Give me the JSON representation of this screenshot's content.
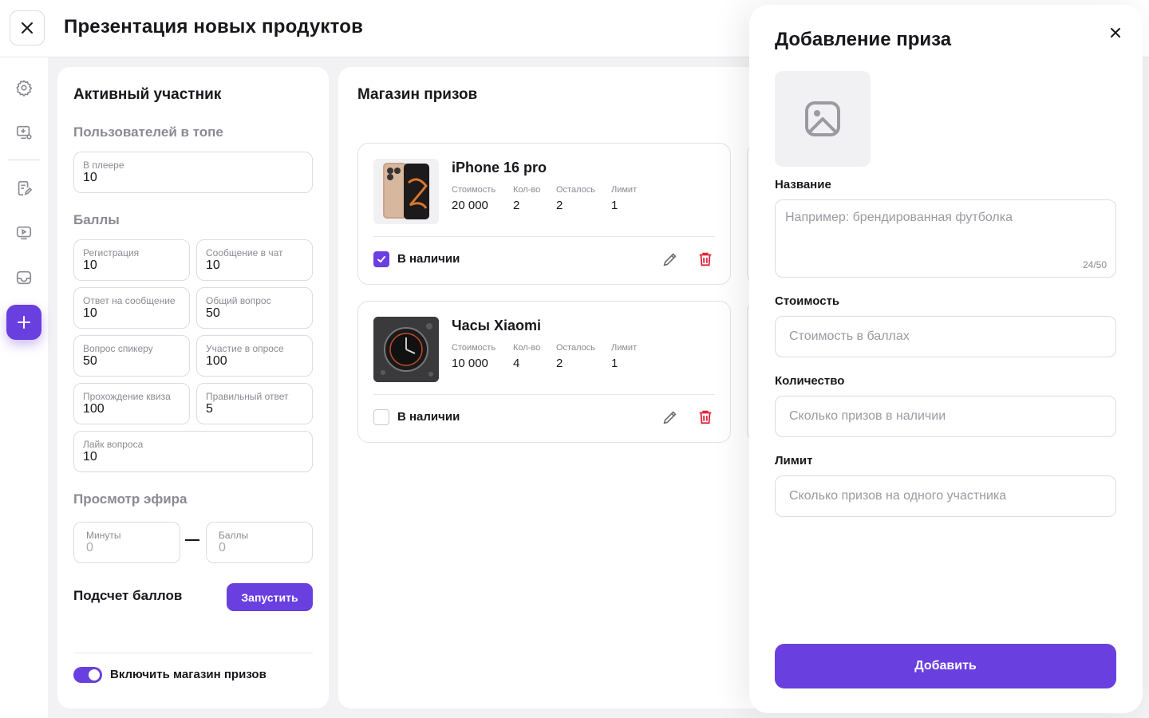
{
  "header": {
    "title": "Презентация новых продуктов"
  },
  "sidebar": {
    "items": [
      "gear-icon",
      "screen-add-icon",
      "edit-doc-icon",
      "play-screen-icon",
      "inbox-icon",
      "plus-icon"
    ]
  },
  "active_participant": {
    "title": "Активный участник",
    "top_users_label": "Пользователей в топе",
    "in_player": {
      "label": "В плеере",
      "value": "10"
    },
    "points_label": "Баллы",
    "points": [
      {
        "label": "Регистрация",
        "value": "10"
      },
      {
        "label": "Сообщение в чат",
        "value": "10"
      },
      {
        "label": "Ответ на сообщение",
        "value": "10"
      },
      {
        "label": "Общий вопрос",
        "value": "50"
      },
      {
        "label": "Вопрос спикеру",
        "value": "50"
      },
      {
        "label": "Участие в опросе",
        "value": "100"
      },
      {
        "label": "Прохождение квиза",
        "value": "100"
      },
      {
        "label": "Правильный ответ",
        "value": "5"
      },
      {
        "label": "Лайк вопроса",
        "value": "10"
      }
    ],
    "view_label": "Просмотр эфира",
    "view_minutes": {
      "label": "Минуты",
      "value": "0"
    },
    "view_points": {
      "label": "Баллы",
      "value": "0"
    },
    "calc_label": "Подсчет баллов",
    "run_button": "Запустить",
    "shop_toggle_label": "Включить магазин призов",
    "shop_toggle_on": true
  },
  "prize_shop": {
    "title": "Магазин призов",
    "stat_labels": {
      "cost": "Стоимость",
      "qty": "Кол-во",
      "left": "Осталось",
      "limit": "Лимит"
    },
    "available_label": "В наличии",
    "items": [
      {
        "name": "iPhone 16 pro",
        "cost": "20 000",
        "qty": "2",
        "left": "2",
        "limit": "1",
        "in_stock": true
      },
      {
        "name": "Часы Xiaomi",
        "cost": "10 000",
        "qty": "4",
        "left": "2",
        "limit": "1",
        "in_stock": false
      }
    ]
  },
  "drawer": {
    "title": "Добавление приза",
    "name_label": "Название",
    "name_placeholder": "Например: брендированная футболка",
    "name_counter": "24/50",
    "cost_label": "Стоимость",
    "cost_placeholder": "Стоимость в баллах",
    "qty_label": "Количество",
    "qty_placeholder": "Сколько призов в наличии",
    "limit_label": "Лимит",
    "limit_placeholder": "Сколько призов на одного участника",
    "submit_label": "Добавить"
  },
  "colors": {
    "accent": "#6a3fe0",
    "danger": "#e0243a",
    "background": "#f2f2f4"
  }
}
